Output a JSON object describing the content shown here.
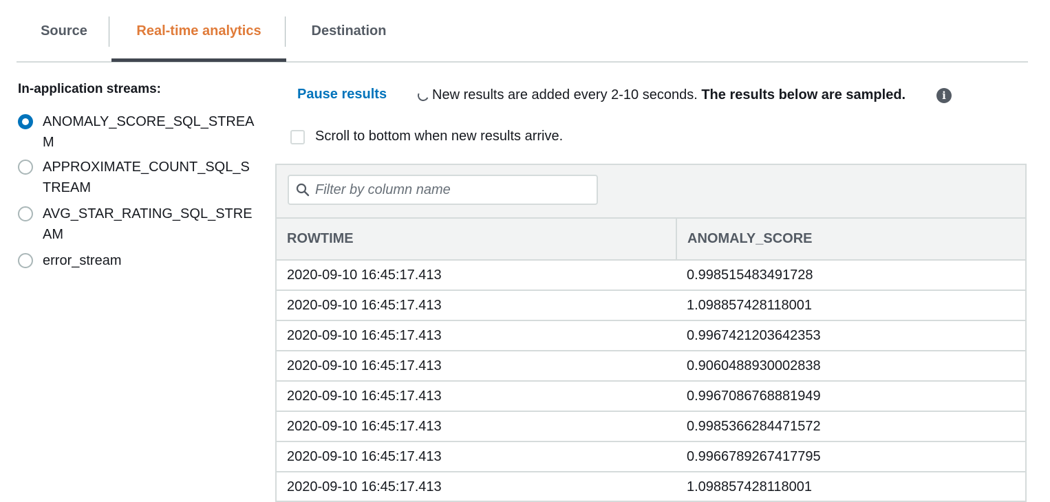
{
  "tabs": [
    {
      "label": "Source"
    },
    {
      "label": "Real-time analytics"
    },
    {
      "label": "Destination"
    }
  ],
  "sidebar": {
    "title": "In-application streams:",
    "streams": [
      {
        "label": "ANOMALY_SCORE_SQL_STREAM",
        "selected": true
      },
      {
        "label": "APPROXIMATE_COUNT_SQL_STREAM",
        "selected": false
      },
      {
        "label": "AVG_STAR_RATING_SQL_STREAM",
        "selected": false
      },
      {
        "label": "error_stream",
        "selected": false
      }
    ]
  },
  "toolbar": {
    "pause_label": "Pause results",
    "status_text": "New results are added every 2-10 seconds.",
    "status_bold": "The results below are sampled.",
    "info_icon": "i",
    "scroll_label": "Scroll to bottom when new results arrive."
  },
  "filter": {
    "placeholder": "Filter by column name",
    "value": ""
  },
  "table": {
    "columns": [
      "ROWTIME",
      "ANOMALY_SCORE"
    ],
    "rows": [
      [
        "2020-09-10 16:45:17.413",
        "0.998515483491728"
      ],
      [
        "2020-09-10 16:45:17.413",
        "1.098857428118001"
      ],
      [
        "2020-09-10 16:45:17.413",
        "0.9967421203642353"
      ],
      [
        "2020-09-10 16:45:17.413",
        "0.9060488930002838"
      ],
      [
        "2020-09-10 16:45:17.413",
        "0.9967086768881949"
      ],
      [
        "2020-09-10 16:45:17.413",
        "0.9985366284471572"
      ],
      [
        "2020-09-10 16:45:17.413",
        "0.9966789267417795"
      ],
      [
        "2020-09-10 16:45:17.413",
        "1.098857428118001"
      ]
    ]
  },
  "colors": {
    "accent_orange": "#e07b39",
    "link_blue": "#0073bb",
    "border": "#d5dbdb",
    "header_bg": "#f2f3f3"
  }
}
